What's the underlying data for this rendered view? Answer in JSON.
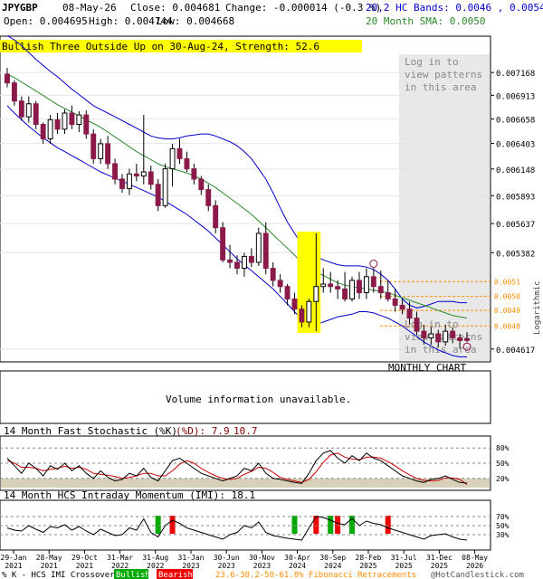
{
  "header": {
    "symbol": "JPYGBP",
    "date": "08-May-26",
    "close": "Close: 0.004681",
    "change": "Change: -0.000014 (-0.3 %)",
    "open": "Open: 0.004695",
    "high": "High: 0.004744",
    "low": "Low: 0.004668",
    "hc_bands": "20,2 HC Bands: 0.0046 , 0.0054",
    "sma": "20 Month SMA: 0.0050"
  },
  "pattern_banner": "Bullish Three Outside Up on 30-Aug-24, Strength: 52.6",
  "login_msg": [
    "Log in to",
    "view patterns",
    "in this area"
  ],
  "monthly_label": "MONTHLY CHART",
  "volume_msg": "Volume information unavailable.",
  "stoch": {
    "title": "14 Month Fast Stochastic (%K)",
    "d_label": "(%D): 7.9",
    "k_value": "10.7",
    "levels": [
      "80%",
      "50%",
      "20%"
    ]
  },
  "imi": {
    "title": "14 Month HCS Intraday Momentum (IMI): 18.1",
    "levels": [
      "70%",
      "50%",
      "30%"
    ]
  },
  "axis_right_label": "Logarithmic",
  "price_ticks": [
    "0.007168",
    "0.006913",
    "0.006658",
    "0.006403",
    "0.006148",
    "0.005893",
    "0.005637",
    "0.005382",
    "0.004617"
  ],
  "fib_levels": [
    "0.0051",
    "0.0050",
    "0.0049",
    "0.0048"
  ],
  "x_ticks": [
    [
      "29-Jan",
      "2021"
    ],
    [
      "28-May",
      "2021"
    ],
    [
      "29-Oct",
      "2021"
    ],
    [
      "31-Mar",
      "2022"
    ],
    [
      "31-Aug",
      "2022"
    ],
    [
      "31-Jan",
      "2023"
    ],
    [
      "30-Jun",
      "2023"
    ],
    [
      "30-Nov",
      "2023"
    ],
    [
      "30-Apr",
      "2024"
    ],
    [
      "30-Sep",
      "2024"
    ],
    [
      "28-Feb",
      "2025"
    ],
    [
      "31-Jul",
      "2025"
    ],
    [
      "31-Dec",
      "2025"
    ],
    [
      "08-May",
      "2026"
    ]
  ],
  "footer": {
    "left": "% K - HCS IMI Crossover:",
    "bullish": "Bullish",
    "bearish": "Bearish",
    "fib": "23.6-38.2-50-61.8% Fibonacci Retracements",
    "copyright": "@HotCandlestick.com"
  },
  "colors": {
    "bull": "#ffffff",
    "bear": "#8b1a4a",
    "band": "#0000cc",
    "sma": "#2a8a2a",
    "highlight": "#ffff00",
    "fib": "#ff8c00",
    "shade": "#e8e8e8",
    "imi_bull": "#00aa00",
    "imi_bear": "#ee0000"
  },
  "chart_data": {
    "type": "candlestick",
    "scale": "logarithmic",
    "ylim": [
      0.00455,
      0.0074
    ],
    "months": [
      "Jan-21",
      "Feb-21",
      "Mar-21",
      "Apr-21",
      "May-21",
      "Jun-21",
      "Jul-21",
      "Aug-21",
      "Sep-21",
      "Oct-21",
      "Nov-21",
      "Dec-21",
      "Jan-22",
      "Feb-22",
      "Mar-22",
      "Apr-22",
      "May-22",
      "Jun-22",
      "Jul-22",
      "Aug-22",
      "Sep-22",
      "Oct-22",
      "Nov-22",
      "Dec-22",
      "Jan-23",
      "Feb-23",
      "Mar-23",
      "Apr-23",
      "May-23",
      "Jun-23",
      "Jul-23",
      "Aug-23",
      "Sep-23",
      "Oct-23",
      "Nov-23",
      "Dec-23",
      "Jan-24",
      "Feb-24",
      "Mar-24",
      "Apr-24",
      "May-24",
      "Jun-24",
      "Jul-24",
      "Aug-24",
      "Sep-24",
      "Oct-24",
      "Nov-24",
      "Dec-24",
      "Jan-25",
      "Feb-25",
      "Mar-25",
      "Apr-25",
      "May-25",
      "Jun-25",
      "Jul-25",
      "Aug-25",
      "Sep-25",
      "Oct-25",
      "Nov-25",
      "Dec-25",
      "Jan-26",
      "Feb-26",
      "Mar-26",
      "Apr-26",
      "May-26"
    ],
    "ohlc": [
      [
        0.00715,
        0.00722,
        0.007,
        0.00705
      ],
      [
        0.00705,
        0.00708,
        0.0068,
        0.00685
      ],
      [
        0.00685,
        0.0069,
        0.00664,
        0.00668
      ],
      [
        0.00668,
        0.0069,
        0.00662,
        0.00682
      ],
      [
        0.00682,
        0.00685,
        0.00655,
        0.0066
      ],
      [
        0.0066,
        0.00662,
        0.0064,
        0.00645
      ],
      [
        0.00645,
        0.0067,
        0.0064,
        0.00665
      ],
      [
        0.00665,
        0.00672,
        0.0065,
        0.00655
      ],
      [
        0.00655,
        0.00676,
        0.0065,
        0.00672
      ],
      [
        0.00672,
        0.0068,
        0.00655,
        0.0066
      ],
      [
        0.0066,
        0.00674,
        0.00652,
        0.0067
      ],
      [
        0.0067,
        0.00675,
        0.00645,
        0.0065
      ],
      [
        0.0065,
        0.00655,
        0.0062,
        0.00625
      ],
      [
        0.00625,
        0.00645,
        0.0062,
        0.0064
      ],
      [
        0.0064,
        0.00648,
        0.00615,
        0.0062
      ],
      [
        0.0062,
        0.00625,
        0.006,
        0.00605
      ],
      [
        0.00605,
        0.0061,
        0.00592,
        0.00596
      ],
      [
        0.00596,
        0.00615,
        0.0059,
        0.0061
      ],
      [
        0.0061,
        0.0062,
        0.00603,
        0.00608
      ],
      [
        0.00608,
        0.0067,
        0.006,
        0.00612
      ],
      [
        0.00612,
        0.00618,
        0.00595,
        0.006
      ],
      [
        0.006,
        0.00605,
        0.00575,
        0.0058
      ],
      [
        0.0058,
        0.0062,
        0.00578,
        0.00615
      ],
      [
        0.00615,
        0.0064,
        0.00598,
        0.00635
      ],
      [
        0.00635,
        0.00645,
        0.0062,
        0.00625
      ],
      [
        0.00625,
        0.00632,
        0.00612,
        0.00615
      ],
      [
        0.00615,
        0.0062,
        0.006,
        0.00605
      ],
      [
        0.00605,
        0.00608,
        0.0059,
        0.00595
      ],
      [
        0.00595,
        0.006,
        0.00575,
        0.0058
      ],
      [
        0.0058,
        0.00585,
        0.00555,
        0.0056
      ],
      [
        0.0056,
        0.00565,
        0.0053,
        0.00532
      ],
      [
        0.00532,
        0.00545,
        0.00525,
        0.0053
      ],
      [
        0.0053,
        0.00536,
        0.0052,
        0.00525
      ],
      [
        0.00525,
        0.00538,
        0.00518,
        0.00535
      ],
      [
        0.00535,
        0.00542,
        0.00526,
        0.0053
      ],
      [
        0.0053,
        0.0056,
        0.00527,
        0.00555
      ],
      [
        0.00555,
        0.00565,
        0.0052,
        0.00525
      ],
      [
        0.00525,
        0.0053,
        0.0051,
        0.00515
      ],
      [
        0.00515,
        0.0052,
        0.00505,
        0.0051
      ],
      [
        0.0051,
        0.00512,
        0.00495,
        0.005
      ],
      [
        0.005,
        0.00505,
        0.00488,
        0.00492
      ],
      [
        0.00492,
        0.00495,
        0.00478,
        0.00482
      ],
      [
        0.00482,
        0.005,
        0.00478,
        0.00498
      ],
      [
        0.00498,
        0.00555,
        0.00475,
        0.0051
      ],
      [
        0.0051,
        0.00525,
        0.00505,
        0.00512
      ],
      [
        0.00512,
        0.00522,
        0.00505,
        0.0051
      ],
      [
        0.0051,
        0.00515,
        0.005,
        0.00508
      ],
      [
        0.00508,
        0.00522,
        0.00498,
        0.005
      ],
      [
        0.005,
        0.00518,
        0.00498,
        0.00515
      ],
      [
        0.00515,
        0.00522,
        0.005,
        0.00505
      ],
      [
        0.00505,
        0.00525,
        0.005,
        0.00518
      ],
      [
        0.00518,
        0.00525,
        0.00505,
        0.0051
      ],
      [
        0.0051,
        0.00523,
        0.005,
        0.00505
      ],
      [
        0.00505,
        0.00515,
        0.00498,
        0.005
      ],
      [
        0.005,
        0.00508,
        0.0049,
        0.00495
      ],
      [
        0.00495,
        0.005,
        0.00488,
        0.00492
      ],
      [
        0.00492,
        0.00498,
        0.0048,
        0.00485
      ],
      [
        0.00485,
        0.0049,
        0.00472,
        0.00475
      ],
      [
        0.00475,
        0.0048,
        0.00465,
        0.0047
      ],
      [
        0.0047,
        0.00478,
        0.00465,
        0.00473
      ],
      [
        0.00473,
        0.00476,
        0.00463,
        0.00467
      ],
      [
        0.00467,
        0.0048,
        0.00464,
        0.00475
      ],
      [
        0.00475,
        0.00478,
        0.00466,
        0.0047
      ],
      [
        0.0047,
        0.00473,
        0.00462,
        0.00468
      ],
      [
        0.004695,
        0.004744,
        0.004668,
        0.004681
      ]
    ],
    "upper_band": [
      0.0076,
      0.00755,
      0.00748,
      0.0074,
      0.00732,
      0.00725,
      0.00718,
      0.00712,
      0.00705,
      0.00698,
      0.00692,
      0.00686,
      0.0068,
      0.00676,
      0.00672,
      0.00668,
      0.00664,
      0.0066,
      0.00656,
      0.00652,
      0.00648,
      0.00646,
      0.00645,
      0.00645,
      0.00646,
      0.00648,
      0.00649,
      0.0065,
      0.0065,
      0.00648,
      0.00645,
      0.00642,
      0.00638,
      0.00632,
      0.00625,
      0.00615,
      0.00605,
      0.00592,
      0.00578,
      0.00565,
      0.00555,
      0.00545,
      0.0054,
      0.00535,
      0.00532,
      0.0053,
      0.00528,
      0.00527,
      0.00527,
      0.00527,
      0.00526,
      0.00524,
      0.0052,
      0.00515,
      0.00508,
      0.005,
      0.00495,
      0.00493,
      0.00494,
      0.00496,
      0.00498,
      0.00498,
      0.00498,
      0.00497,
      0.00497
    ],
    "lower_band": [
      0.0068,
      0.00672,
      0.00665,
      0.00658,
      0.00652,
      0.00646,
      0.00641,
      0.00636,
      0.00632,
      0.00628,
      0.00624,
      0.0062,
      0.00616,
      0.00612,
      0.00609,
      0.00606,
      0.00603,
      0.006,
      0.00597,
      0.00594,
      0.00591,
      0.00588,
      0.00584,
      0.0058,
      0.00576,
      0.00572,
      0.00567,
      0.00562,
      0.00557,
      0.00551,
      0.00545,
      0.00539,
      0.00533,
      0.00528,
      0.00523,
      0.00518,
      0.00513,
      0.00508,
      0.00502,
      0.00496,
      0.0049,
      0.00484,
      0.0048,
      0.0048,
      0.00482,
      0.00484,
      0.00486,
      0.00487,
      0.00488,
      0.0049,
      0.0049,
      0.00489,
      0.00487,
      0.00485,
      0.00482,
      0.00479,
      0.00475,
      0.00471,
      0.00467,
      0.00464,
      0.00461,
      0.00459,
      0.00457,
      0.00456,
      0.00456
    ],
    "sma": [
      0.00715,
      0.00711,
      0.00706,
      0.00701,
      0.00696,
      0.00691,
      0.00686,
      0.00681,
      0.00677,
      0.00673,
      0.00669,
      0.00665,
      0.00661,
      0.00657,
      0.00652,
      0.00647,
      0.00642,
      0.00637,
      0.00632,
      0.00628,
      0.00624,
      0.0062,
      0.00617,
      0.00615,
      0.00613,
      0.00611,
      0.00608,
      0.00605,
      0.00601,
      0.00597,
      0.00592,
      0.00587,
      0.00582,
      0.00577,
      0.00572,
      0.00566,
      0.0056,
      0.00554,
      0.00548,
      0.00542,
      0.00536,
      0.0053,
      0.00526,
      0.00522,
      0.00519,
      0.00516,
      0.00513,
      0.00511,
      0.0051,
      0.00509,
      0.00508,
      0.00507,
      0.00506,
      0.00505,
      0.00503,
      0.00501,
      0.00499,
      0.00497,
      0.00495,
      0.00493,
      0.00491,
      0.00489,
      0.00487,
      0.00486,
      0.00485
    ],
    "fib_values": [
      0.00514,
      0.00502,
      0.00491,
      0.00479
    ],
    "stoch_k": [
      60,
      45,
      30,
      50,
      40,
      25,
      45,
      38,
      50,
      35,
      45,
      30,
      20,
      35,
      22,
      15,
      18,
      30,
      25,
      40,
      22,
      15,
      35,
      55,
      60,
      50,
      40,
      30,
      25,
      20,
      15,
      20,
      25,
      40,
      35,
      50,
      30,
      20,
      18,
      15,
      12,
      10,
      30,
      55,
      70,
      75,
      60,
      50,
      65,
      55,
      70,
      60,
      55,
      45,
      35,
      25,
      20,
      15,
      12,
      18,
      20,
      25,
      18,
      12,
      10.7
    ],
    "stoch_d": [
      55,
      50,
      42,
      42,
      40,
      35,
      38,
      40,
      44,
      40,
      42,
      38,
      30,
      28,
      26,
      24,
      20,
      22,
      25,
      30,
      30,
      25,
      25,
      35,
      48,
      55,
      50,
      40,
      32,
      25,
      20,
      18,
      20,
      28,
      34,
      42,
      40,
      32,
      22,
      18,
      15,
      12,
      18,
      33,
      52,
      66,
      70,
      62,
      58,
      57,
      62,
      62,
      60,
      53,
      45,
      35,
      27,
      20,
      16,
      15,
      16,
      21,
      21,
      18,
      7.9
    ],
    "imi": [
      45,
      40,
      38,
      50,
      42,
      35,
      48,
      45,
      52,
      40,
      48,
      38,
      30,
      42,
      35,
      28,
      30,
      45,
      40,
      65,
      35,
      25,
      50,
      62,
      55,
      45,
      40,
      35,
      30,
      25,
      20,
      30,
      35,
      50,
      45,
      58,
      35,
      28,
      25,
      22,
      20,
      18,
      45,
      70,
      68,
      62,
      55,
      52,
      66,
      50,
      60,
      55,
      52,
      45,
      40,
      35,
      30,
      25,
      20,
      28,
      30,
      32,
      25,
      20,
      18.1
    ],
    "imi_signals": [
      {
        "month": 21,
        "type": "bullish"
      },
      {
        "month": 23,
        "type": "bearish"
      },
      {
        "month": 40,
        "type": "bullish"
      },
      {
        "month": 43,
        "type": "bearish"
      },
      {
        "month": 45,
        "type": "bullish"
      },
      {
        "month": 46,
        "type": "bearish"
      },
      {
        "month": 48,
        "type": "bullish"
      },
      {
        "month": 53,
        "type": "bearish"
      }
    ],
    "pattern_month": 43
  }
}
